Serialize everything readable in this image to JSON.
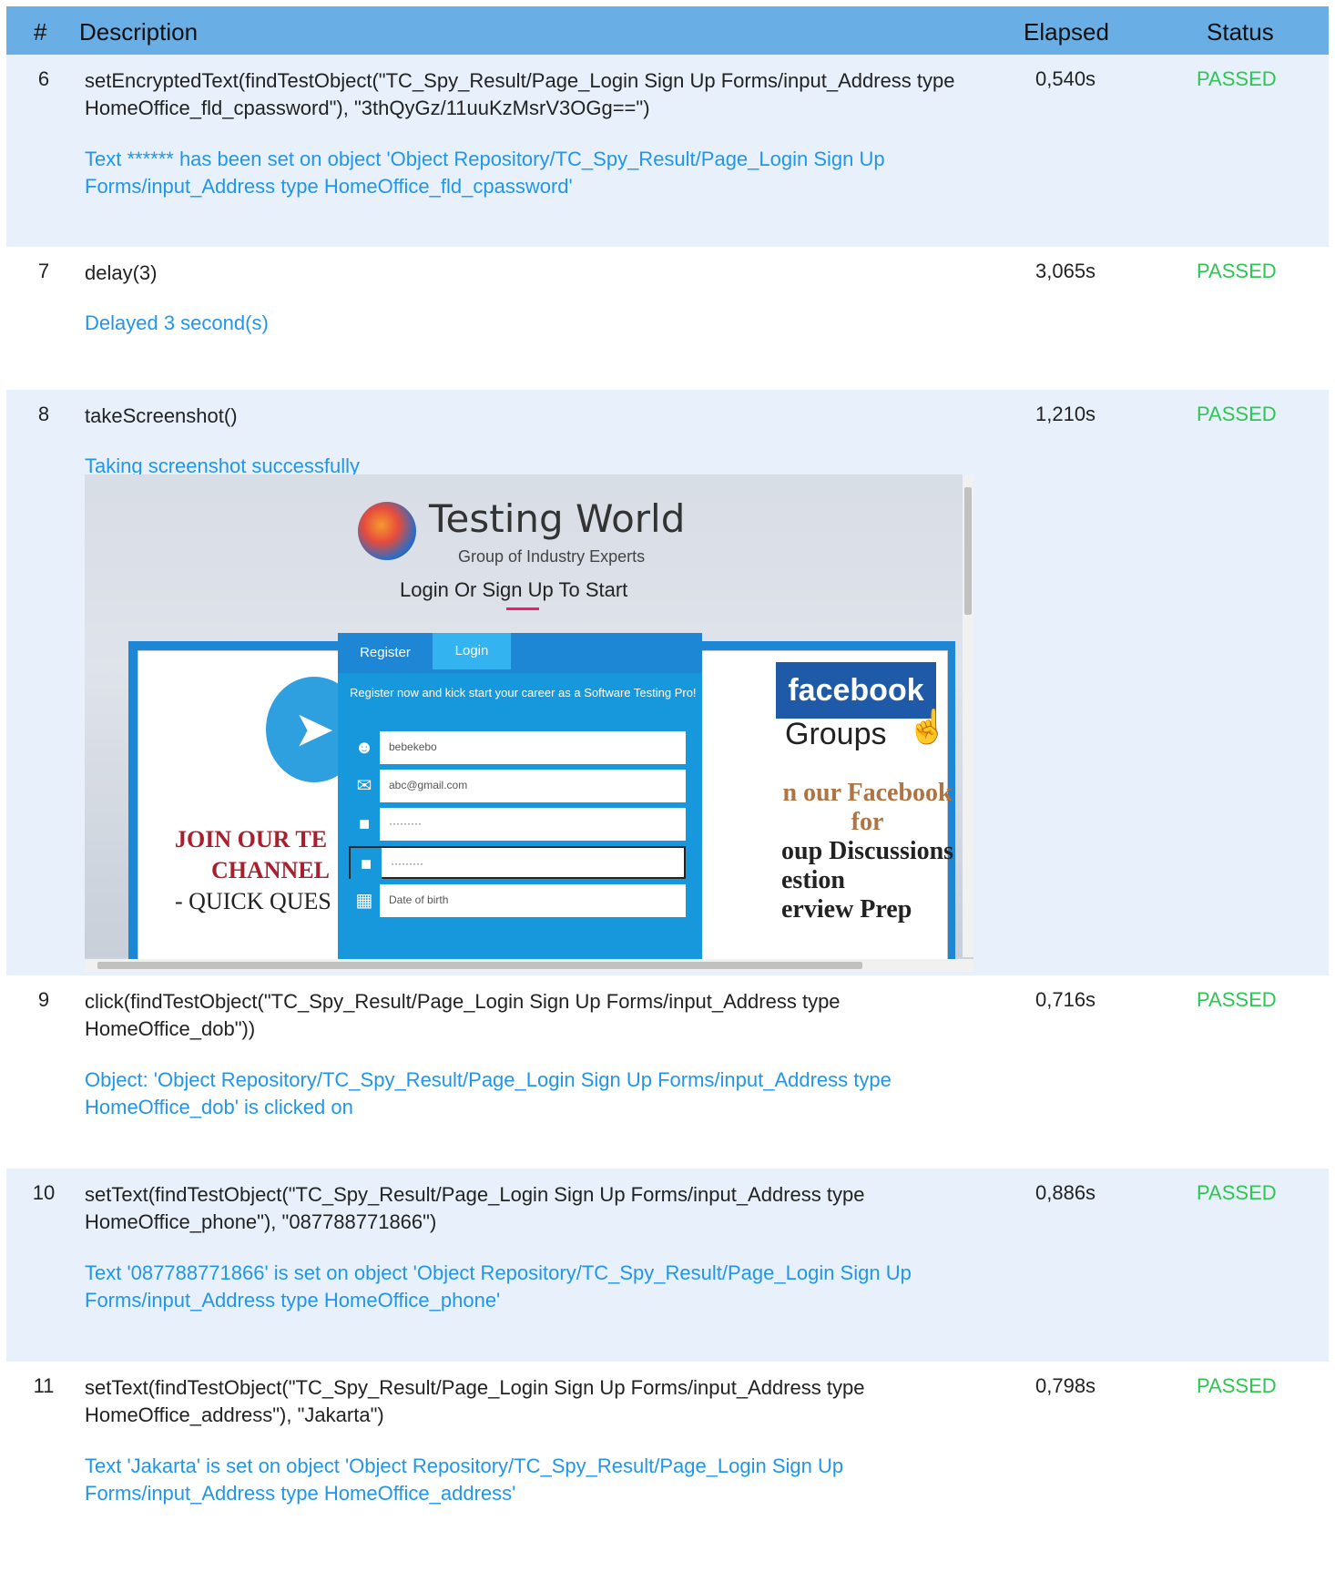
{
  "header": {
    "num": "#",
    "description": "Description",
    "elapsed": "Elapsed",
    "status": "Status"
  },
  "rows": [
    {
      "num": "6",
      "description": "setEncryptedText(findTestObject(\"TC_Spy_Result/Page_Login  Sign Up Forms/input_Address type HomeOffice_fld_cpassword\"), \"3thQyGz/11uuKzMsrV3OGg==\")",
      "elapsed": "0,540s",
      "status": "PASSED",
      "message": "Text ****** has been set on object 'Object Repository/TC_Spy_Result/Page_Login  Sign Up Forms/input_Address type HomeOffice_fld_cpassword'"
    },
    {
      "num": "7",
      "description": "delay(3)",
      "elapsed": "3,065s",
      "status": "PASSED",
      "message": "Delayed 3 second(s)"
    },
    {
      "num": "8",
      "description": "takeScreenshot()",
      "elapsed": "1,210s",
      "status": "PASSED",
      "message": "Taking screenshot successfully"
    },
    {
      "num": "9",
      "description": "click(findTestObject(\"TC_Spy_Result/Page_Login  Sign Up Forms/input_Address type HomeOffice_dob\"))",
      "elapsed": "0,716s",
      "status": "PASSED",
      "message": "Object: 'Object Repository/TC_Spy_Result/Page_Login  Sign Up Forms/input_Address type HomeOffice_dob' is clicked on"
    },
    {
      "num": "10",
      "description": "setText(findTestObject(\"TC_Spy_Result/Page_Login  Sign Up Forms/input_Address type HomeOffice_phone\"), \"087788771866\")",
      "elapsed": "0,886s",
      "status": "PASSED",
      "message": "Text '087788771866' is set on object 'Object Repository/TC_Spy_Result/Page_Login  Sign Up Forms/input_Address type HomeOffice_phone'"
    },
    {
      "num": "11",
      "description": "setText(findTestObject(\"TC_Spy_Result/Page_Login  Sign Up Forms/input_Address type HomeOffice_address\"), \"Jakarta\")",
      "elapsed": "0,798s",
      "status": "PASSED",
      "message": "Text 'Jakarta' is set on object 'Object Repository/TC_Spy_Result/Page_Login  Sign Up Forms/input_Address type HomeOffice_address'"
    }
  ],
  "screenshot": {
    "logo_title": "Testing World",
    "logo_subtitle": "Group of Industry Experts",
    "heading": "Login Or Sign Up To Start",
    "tab_register": "Register",
    "tab_login": "Login",
    "register_note": "Register now and kick start your career as a Software Testing Pro!",
    "field_name": "bebekebo",
    "field_email": "abc@gmail.com",
    "field_password": "·········",
    "field_confirm": "·········",
    "field_dob_placeholder": "Date of birth",
    "left_card_line1": "JOIN OUR TE",
    "left_card_line2": "CHANNEL",
    "left_card_line3": "- QUICK QUES",
    "fb_logo": "facebook",
    "fb_groups": "Groups",
    "fb_line1": "n our Facebook",
    "fb_line2": "for",
    "fb_line3": "oup Discussions",
    "fb_line4": "estion",
    "fb_line5": "erview Prep"
  }
}
